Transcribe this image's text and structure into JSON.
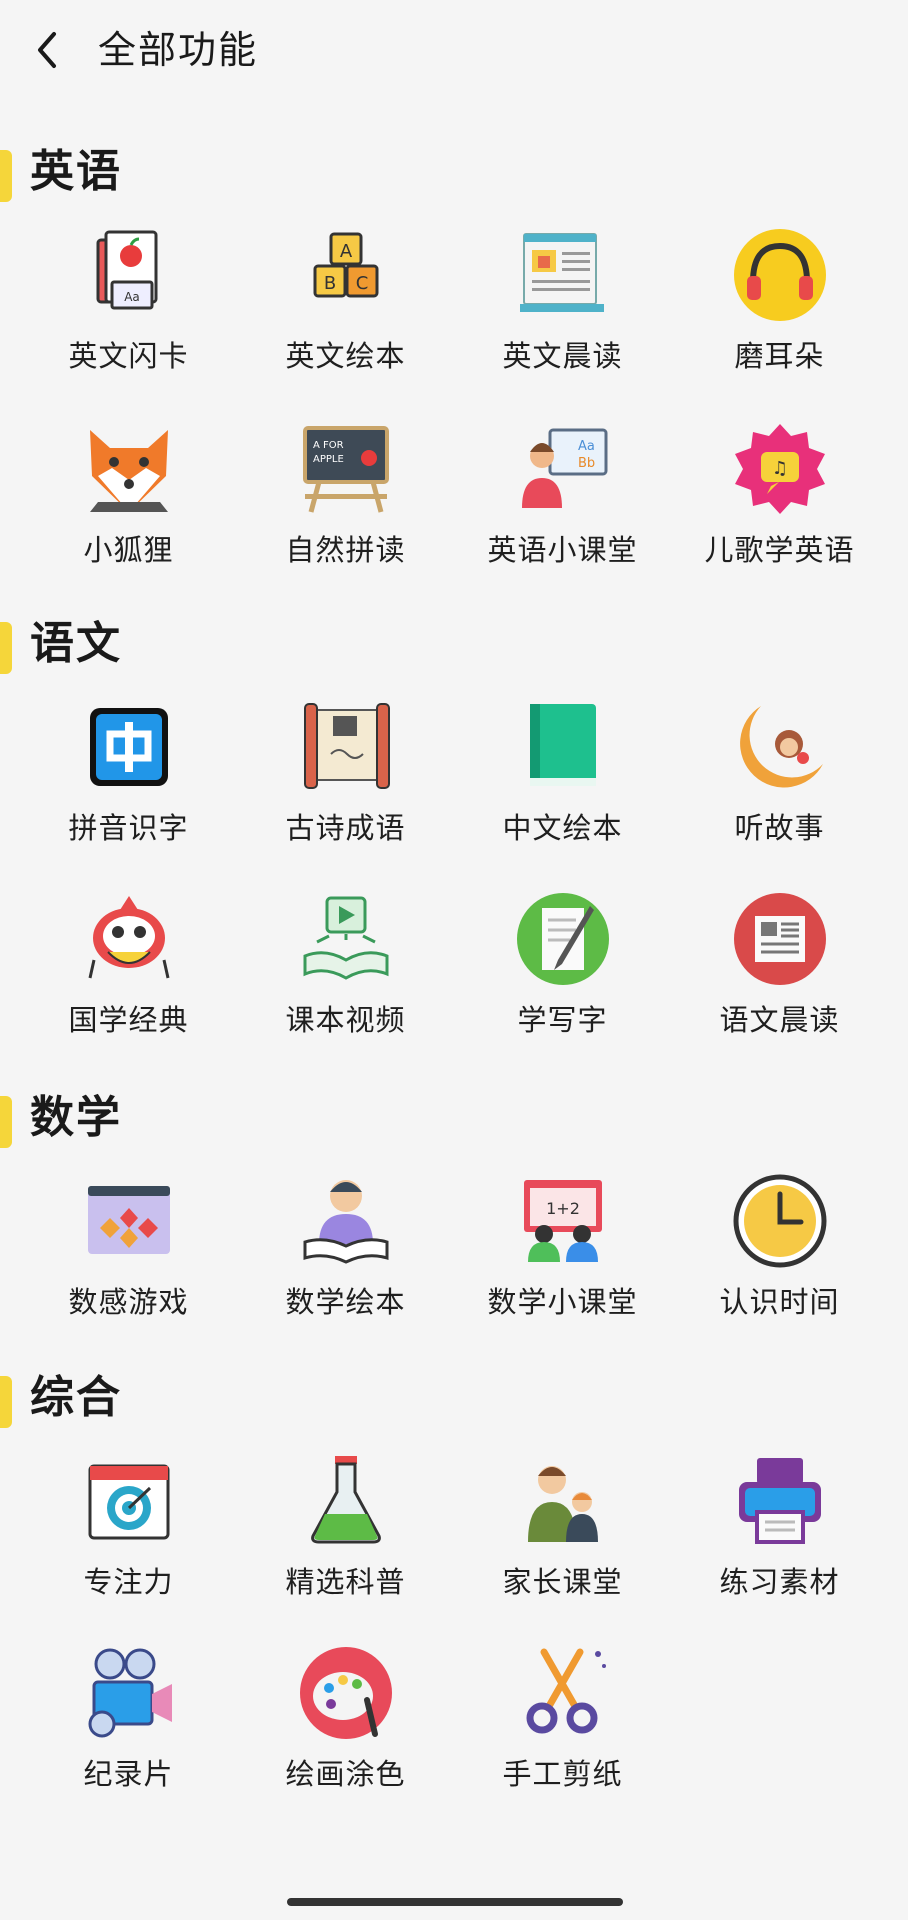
{
  "header": {
    "title": "全部功能"
  },
  "sections": [
    {
      "title": "英语",
      "items": [
        {
          "label": "英文闪卡",
          "icon": "flashcard-icon"
        },
        {
          "label": "英文绘本",
          "icon": "abc-blocks-icon"
        },
        {
          "label": "英文晨读",
          "icon": "newspaper-icon"
        },
        {
          "label": "磨耳朵",
          "icon": "headphones-icon"
        },
        {
          "label": "小狐狸",
          "icon": "fox-icon"
        },
        {
          "label": "自然拼读",
          "icon": "chalkboard-icon"
        },
        {
          "label": "英语小课堂",
          "icon": "teacher-icon"
        },
        {
          "label": "儿歌学英语",
          "icon": "music-badge-icon"
        }
      ]
    },
    {
      "title": "语文",
      "items": [
        {
          "label": "拼音识字",
          "icon": "zhong-character-icon"
        },
        {
          "label": "古诗成语",
          "icon": "scroll-icon"
        },
        {
          "label": "中文绘本",
          "icon": "green-book-icon"
        },
        {
          "label": "听故事",
          "icon": "moon-monkey-icon"
        },
        {
          "label": "国学经典",
          "icon": "lion-dance-icon"
        },
        {
          "label": "课本视频",
          "icon": "video-book-icon"
        },
        {
          "label": "学写字",
          "icon": "pen-paper-icon"
        },
        {
          "label": "语文晨读",
          "icon": "red-newspaper-icon"
        }
      ]
    },
    {
      "title": "数学",
      "items": [
        {
          "label": "数感游戏",
          "icon": "math-game-icon"
        },
        {
          "label": "数学绘本",
          "icon": "reading-child-icon"
        },
        {
          "label": "数学小课堂",
          "icon": "math-class-icon"
        },
        {
          "label": "认识时间",
          "icon": "clock-icon"
        }
      ]
    },
    {
      "title": "综合",
      "items": [
        {
          "label": "专注力",
          "icon": "target-calendar-icon"
        },
        {
          "label": "精选科普",
          "icon": "flask-icon"
        },
        {
          "label": "家长课堂",
          "icon": "parent-child-icon"
        },
        {
          "label": "练习素材",
          "icon": "printer-icon"
        },
        {
          "label": "纪录片",
          "icon": "film-camera-icon"
        },
        {
          "label": "绘画涂色",
          "icon": "palette-icon"
        },
        {
          "label": "手工剪纸",
          "icon": "scissors-icon"
        }
      ]
    }
  ]
}
